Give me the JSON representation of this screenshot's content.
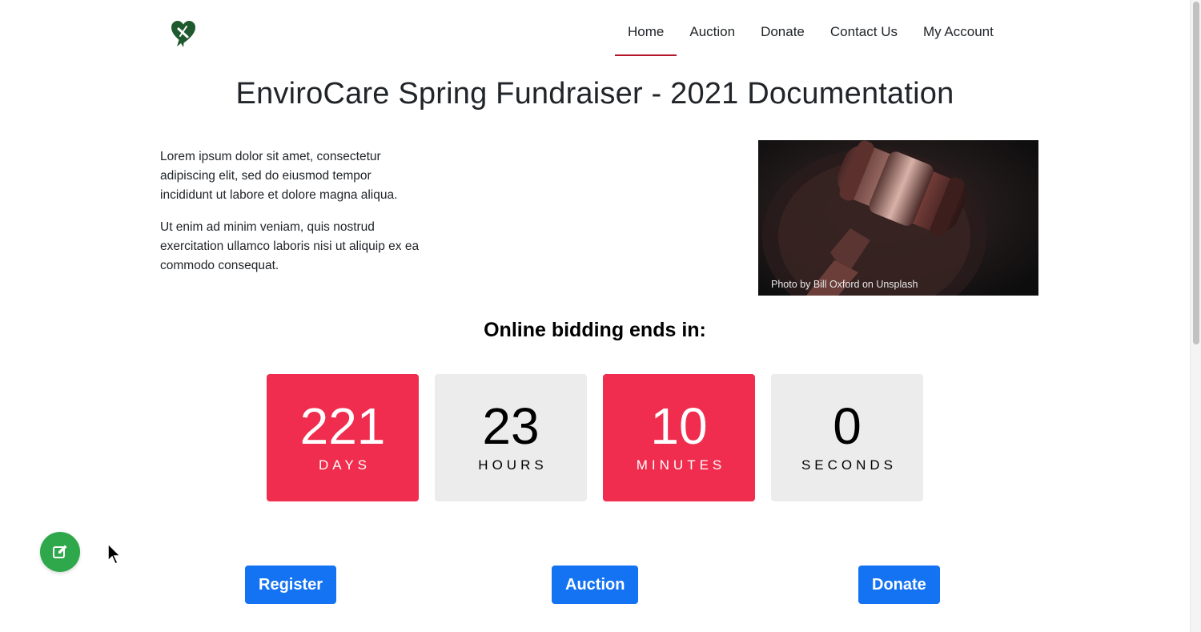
{
  "nav": {
    "items": [
      {
        "label": "Home",
        "active": true
      },
      {
        "label": "Auction",
        "active": false
      },
      {
        "label": "Donate",
        "active": false
      },
      {
        "label": "Contact Us",
        "active": false
      },
      {
        "label": "My Account",
        "active": false
      }
    ],
    "accent_color": "#b5162b"
  },
  "logo": {
    "icon": "heart-ribbon-icon",
    "color": "#1e5a2e"
  },
  "page_title": "EnviroCare Spring Fundraiser - 2021 Documentation",
  "intro": {
    "paragraphs": [
      "Lorem ipsum dolor sit amet, consectetur adipiscing elit, sed do eiusmod tempor incididunt ut labore et dolore magna aliqua.",
      "Ut enim ad minim veniam, quis nostrud exercitation ullamco laboris nisi ut aliquip ex ea commodo consequat."
    ]
  },
  "photo": {
    "subject": "gavel",
    "credit": "Photo by Bill Oxford on Unsplash"
  },
  "countdown": {
    "title": "Online bidding ends in:",
    "units": [
      {
        "value": "221",
        "label": "DAYS",
        "style": "red"
      },
      {
        "value": "23",
        "label": "HOURS",
        "style": "grey"
      },
      {
        "value": "10",
        "label": "MINUTES",
        "style": "red"
      },
      {
        "value": "0",
        "label": "SECONDS",
        "style": "grey"
      }
    ],
    "colors": {
      "red": "#f02d4e",
      "grey": "#ececec"
    }
  },
  "actions": {
    "register": "Register",
    "auction": "Auction",
    "donate": "Donate",
    "button_color": "#1473f2"
  },
  "fab": {
    "icon": "edit-icon",
    "color": "#2ea84a"
  }
}
